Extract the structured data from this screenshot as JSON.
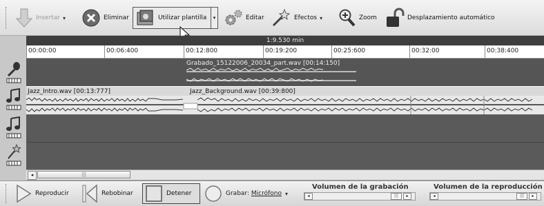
{
  "toolbar": {
    "insertar_label": "Insertar",
    "eliminar_label": "Eliminar",
    "plantilla_label": "Utilizar plantilla",
    "editar_label": "Editar",
    "efectos_label": "Efectos",
    "zoom_label": "Zoom",
    "auto_scroll_label": "Desplazamiento automático",
    "dropdown_glyph": "▾"
  },
  "timeline": {
    "duration": "1:9.530 min",
    "ticks": [
      "00:00:00",
      "00:06:400",
      "00:12:800",
      "00:19:200",
      "00:25:600",
      "00:32:00",
      "00:38:400"
    ]
  },
  "tracks": {
    "voice_clip_label": "Grabado_15122006_20034_part.wav [00:14:150]",
    "music_clip1_label": "Jazz_Intro.wav [00:13:777]",
    "music_clip2_label": "Jazz_Background.wav [00:39:800]"
  },
  "scrollbar": {
    "left_arrow": "◂",
    "thumb_grip": "|||"
  },
  "transport": {
    "play_label": "Reproducir",
    "rewind_label": "Rebobinar",
    "stop_label": "Detener",
    "record_prefix": "Grabar: ",
    "record_source": "Micrófono",
    "dropdown_glyph": "▾",
    "rec_volume_title": "Volumen de la grabación",
    "play_volume_title": "Volumen de la reproducción",
    "arrow_left": "◂",
    "arrow_right": "▸",
    "thumb_grip": "|||"
  }
}
